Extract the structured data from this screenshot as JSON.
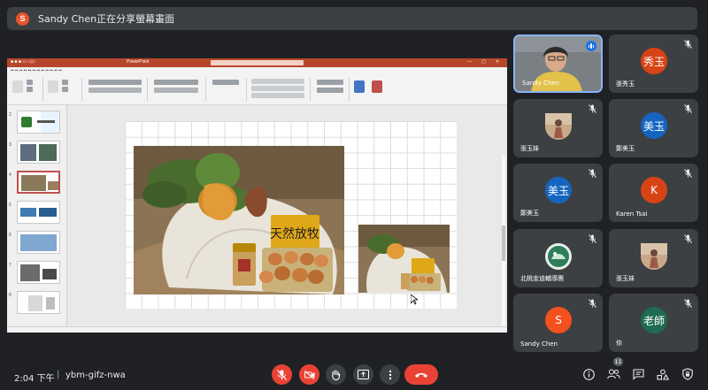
{
  "banner": {
    "avatar_letter": "S",
    "text": "Sandy Chen正在分享螢幕畫面"
  },
  "shared_screen": {
    "app": "PowerPoint",
    "slide_sign": "天然放牧",
    "thumbnail_numbers": [
      "2",
      "3",
      "4",
      "5",
      "6",
      "7",
      "8"
    ],
    "selected_thumbnail": 4
  },
  "participants": [
    {
      "name": "Sandy Chen",
      "type": "video",
      "speaking": true
    },
    {
      "name": "張秀玉",
      "avatar_text": "秀玉",
      "avatar_color": "#d84315",
      "muted": true
    },
    {
      "name": "張玉妹",
      "type": "photo",
      "muted": true
    },
    {
      "name": "鄭美玉",
      "avatar_text": "美玉",
      "avatar_color": "#1565c0",
      "muted": true
    },
    {
      "name": "鄭美玉",
      "avatar_text": "美玉",
      "avatar_color": "#1565c0",
      "muted": true
    },
    {
      "name": "Karen Tsai",
      "avatar_text": "K",
      "avatar_color": "#d84315",
      "muted": true
    },
    {
      "name": "北桃金迪輔導團",
      "type": "logo",
      "muted": true
    },
    {
      "name": "張玉妹",
      "type": "photo",
      "muted": true
    },
    {
      "name": "Sandy Chen",
      "avatar_text": "S",
      "avatar_color": "#f4511e",
      "muted": true
    },
    {
      "name": "你",
      "avatar_text": "老師",
      "avatar_color": "#1e6b52",
      "muted": true
    }
  ],
  "bottom_bar": {
    "time": "2:04 下午",
    "separator": "|",
    "meeting_code": "ybm-gifz-nwa",
    "people_count": "11"
  }
}
